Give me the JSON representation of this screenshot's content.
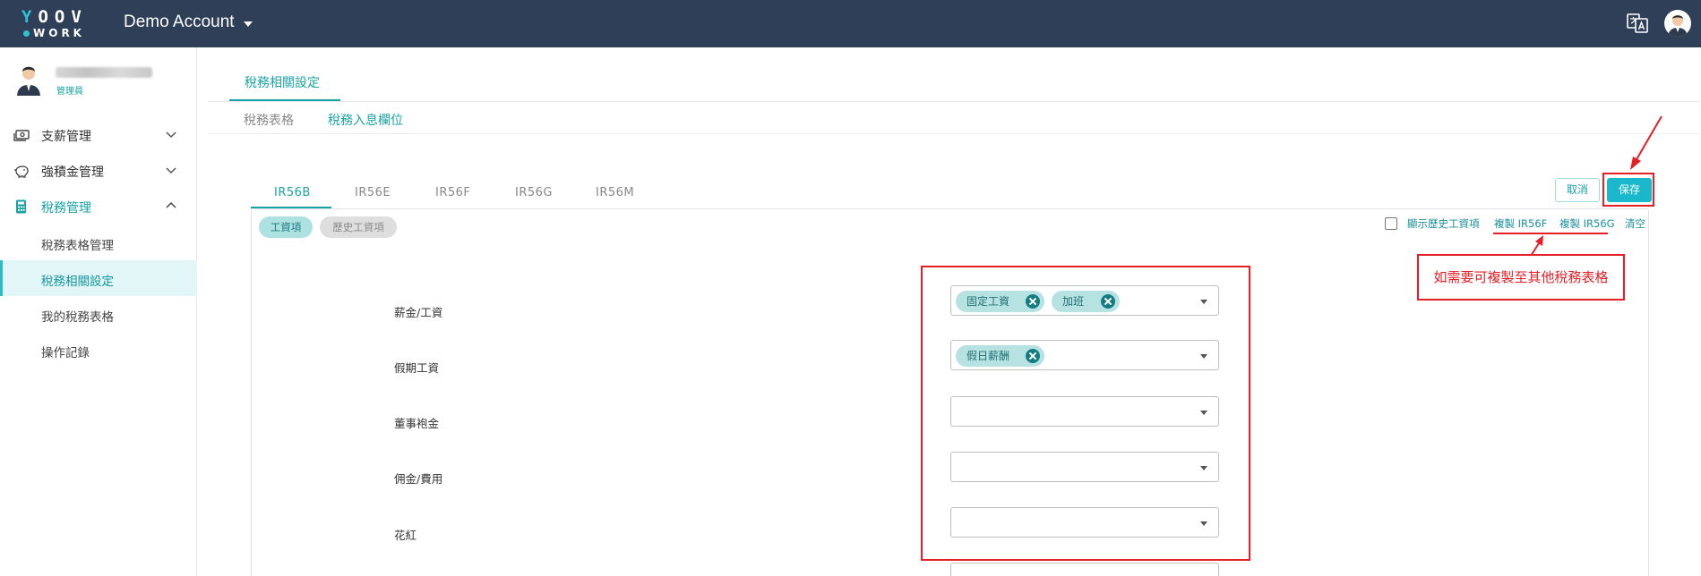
{
  "header": {
    "logo_top": "YOOV",
    "logo_bottom": "WORK",
    "account_label": "Demo Account"
  },
  "sidebar": {
    "user_role": "管理員",
    "groups": [
      {
        "label": "支薪管理",
        "icon": "money-icon"
      },
      {
        "label": "強積金管理",
        "icon": "piggy-bank-icon"
      },
      {
        "label": "稅務管理",
        "icon": "calculator-icon"
      }
    ],
    "tax_items": [
      "稅務表格管理",
      "稅務相關設定",
      "我的稅務表格",
      "操作記錄"
    ]
  },
  "main": {
    "page_tab": "稅務相關設定",
    "subtabs": [
      "稅務表格",
      "稅務入息欄位"
    ],
    "form_tabs": [
      "IR56B",
      "IR56E",
      "IR56F",
      "IR56G",
      "IR56M"
    ],
    "cancel_label": "取消",
    "save_label": "保存",
    "pills": [
      "工資項",
      "歷史工資項"
    ],
    "show_history_label": "顯示歷史工資項",
    "copy_f_label": "複製 IR56F",
    "copy_g_label": "複製 IR56G",
    "clear_label": "清空",
    "note": "如需要可複製至其他稅務表格",
    "fields": [
      {
        "label": "薪金/工資",
        "chips": [
          "固定工資",
          "加班"
        ]
      },
      {
        "label": "假期工資",
        "chips": [
          "假日薪酬"
        ]
      },
      {
        "label": "董事袍金",
        "chips": []
      },
      {
        "label": "佣金/費用",
        "chips": []
      },
      {
        "label": "花紅",
        "chips": []
      }
    ]
  },
  "colors": {
    "topbar": "#2f3f58",
    "accent": "#1aa3a3",
    "save": "#1bb8cc",
    "annotation": "#e61e26"
  }
}
